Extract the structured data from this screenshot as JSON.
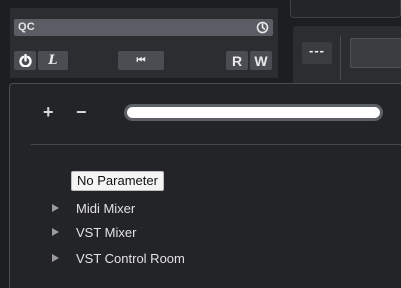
{
  "quick_controls": {
    "title": "QC",
    "buttons": {
      "read": "R",
      "write": "W",
      "learn": "L",
      "rewind": "⏮"
    }
  },
  "right_panel": {
    "dots": "---"
  },
  "parameter_popup": {
    "add_label": "+",
    "remove_label": "−",
    "search_value": "",
    "tooltip": "No Parameter",
    "tree_items": [
      {
        "label": "Midi Mixer"
      },
      {
        "label": "VST Mixer"
      },
      {
        "label": "VST Control Room"
      }
    ]
  }
}
